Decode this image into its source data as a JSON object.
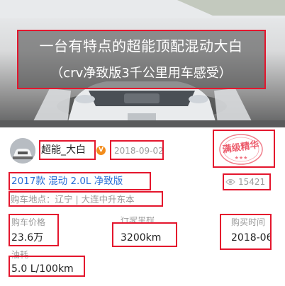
{
  "hero": {
    "caption_line1": "一台有特点的超能顶配混动大白",
    "caption_line2": "（crv净致版3千公里用车感受）"
  },
  "author": {
    "name": "超能_大白",
    "verified_icon": "verified-v-icon",
    "date": "2018-09-02"
  },
  "badge": {
    "text": "满级精华",
    "color": "#e4162d"
  },
  "post": {
    "version_title": "2017款 混动 2.0L 净致版",
    "views": "15421",
    "location": "购车地点：辽宁 | 大连中升东本"
  },
  "specs": {
    "price_label": "购车价格",
    "price_value": "23.6万",
    "mileage_label": "行驶里程",
    "mileage_value": "3200km",
    "purchase_time_label": "购买时间",
    "purchase_time_value": "2018-06",
    "fuel_label": "油耗",
    "fuel_value": "5.0 L/100km"
  },
  "colors": {
    "accent_blue": "#2a6fd6",
    "annotation_red": "#e4162d",
    "muted_gray": "#9a9a9a",
    "verified_orange": "#f28c1c"
  }
}
